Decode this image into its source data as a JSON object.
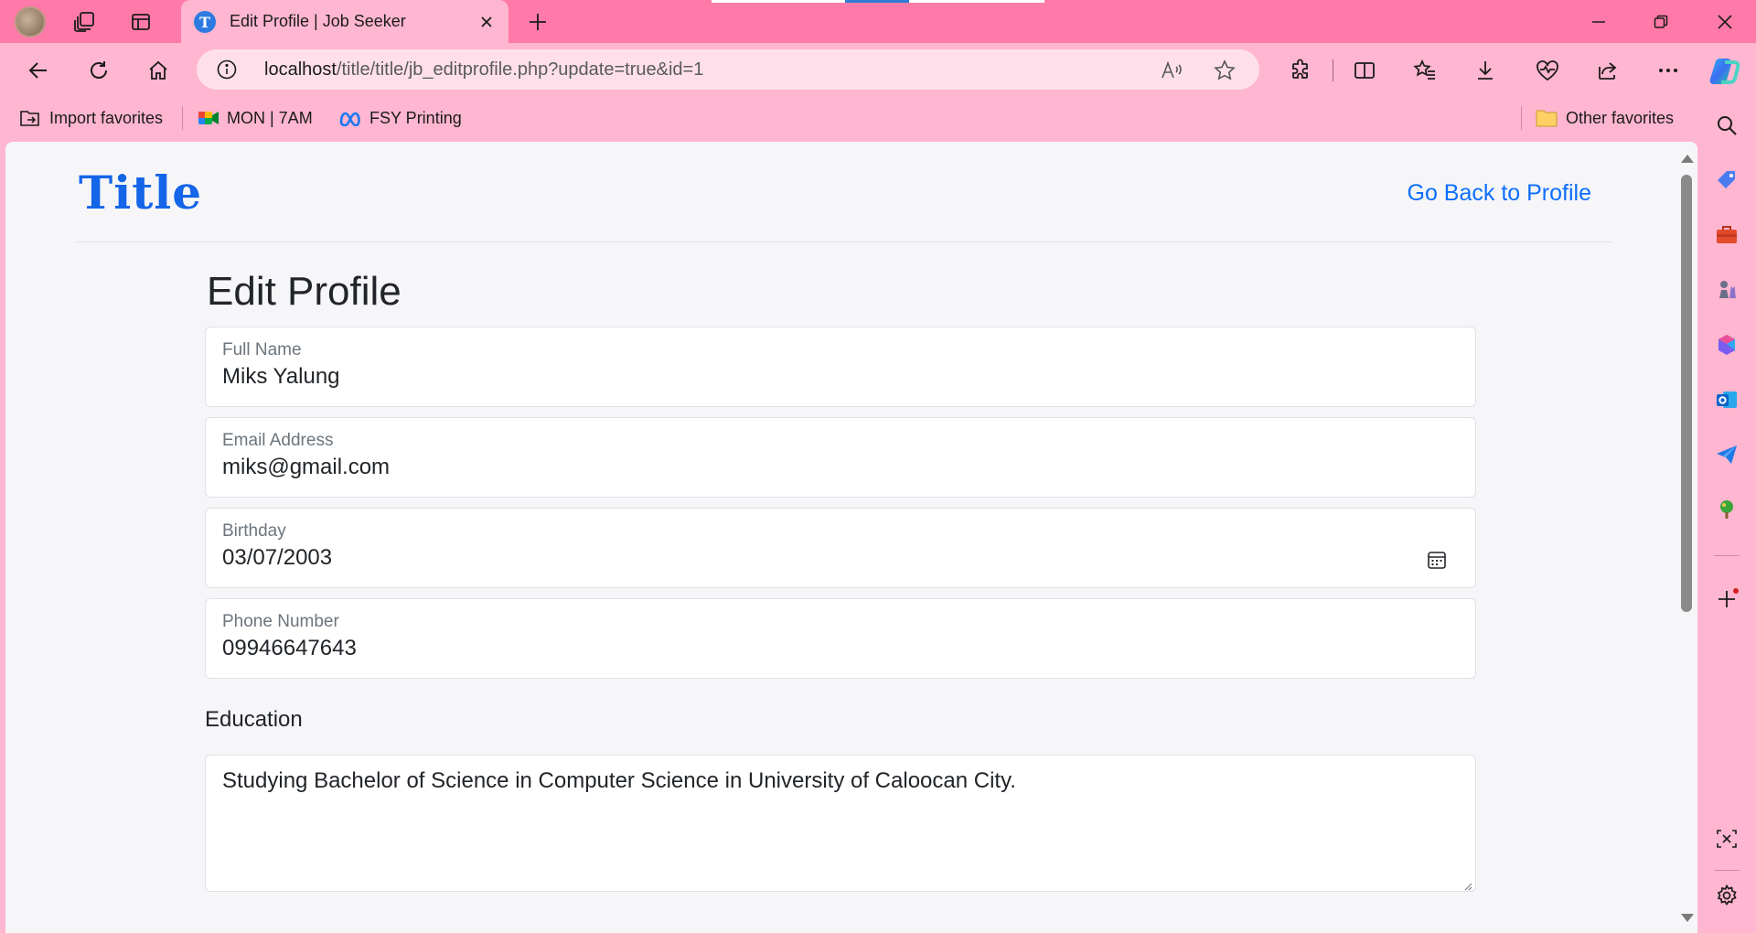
{
  "browser": {
    "tab_title": "Edit Profile | Job Seeker",
    "url_host": "localhost",
    "url_path": "/title/title/jb_editprofile.php?update=true&id=1",
    "favorites": [
      {
        "label": "Import favorites",
        "icon": "import-favorites-icon"
      },
      {
        "label": "MON | 7AM",
        "icon": "google-meet-icon"
      },
      {
        "label": "FSY Printing",
        "icon": "meta-icon"
      }
    ],
    "other_favorites": "Other favorites",
    "accent_color": "#ff7aa8",
    "toolbar_color": "#ffb6d0"
  },
  "site": {
    "logo": "Title",
    "back_link": "Go Back to Profile",
    "link_color": "#0d6efd"
  },
  "form": {
    "title": "Edit Profile",
    "fields": {
      "full_name": {
        "label": "Full Name",
        "value": "Miks Yalung"
      },
      "email": {
        "label": "Email Address",
        "value": "miks@gmail.com"
      },
      "birthday": {
        "label": "Birthday",
        "value": "03/07/2003"
      },
      "phone": {
        "label": "Phone Number",
        "value": "09946647643"
      }
    },
    "education": {
      "label": "Education",
      "value": "Studying Bachelor of Science in Computer Science in University of Caloocan City."
    }
  }
}
